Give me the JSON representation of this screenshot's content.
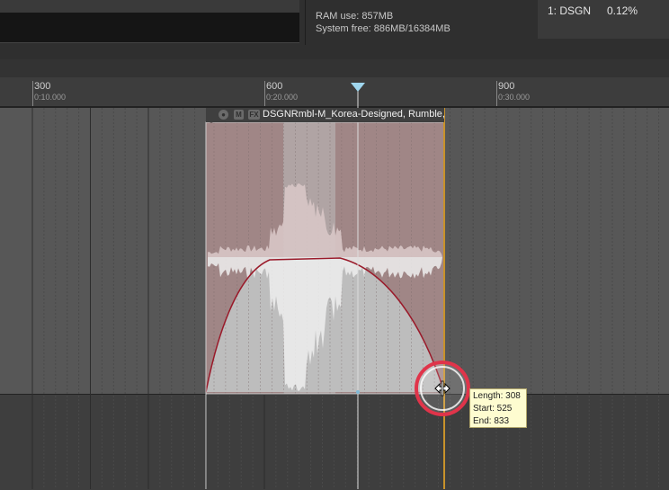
{
  "status": {
    "ram_use": "RAM use: 857MB",
    "system_free": "System free: 886MB/16384MB"
  },
  "cpu": {
    "name": "1: DSGN",
    "value": "0.12%"
  },
  "ruler": {
    "ticks": [
      {
        "label": "300",
        "time": "0:10.000"
      },
      {
        "label": "600",
        "time": "0:20.000"
      },
      {
        "label": "900",
        "time": "0:30.000"
      }
    ]
  },
  "clip": {
    "title": "DSGNRmbl-M_Korea-Designed, Rumble,",
    "mute_label": "M",
    "fx_label": "FX"
  },
  "tooltip": {
    "length": "Length: 308",
    "start": "Start: 525",
    "end": "End: 833"
  },
  "colors": {
    "clip_tint": "#9c8080",
    "fade_curve": "#9a1a2a",
    "cursor_ring": "#e0344a",
    "edit_line": "#c8922a",
    "playhead": "#9fd6ee"
  },
  "icons": {
    "playhead": "playhead-marker-icon",
    "cursor": "resize-horizontal-cursor-icon"
  }
}
